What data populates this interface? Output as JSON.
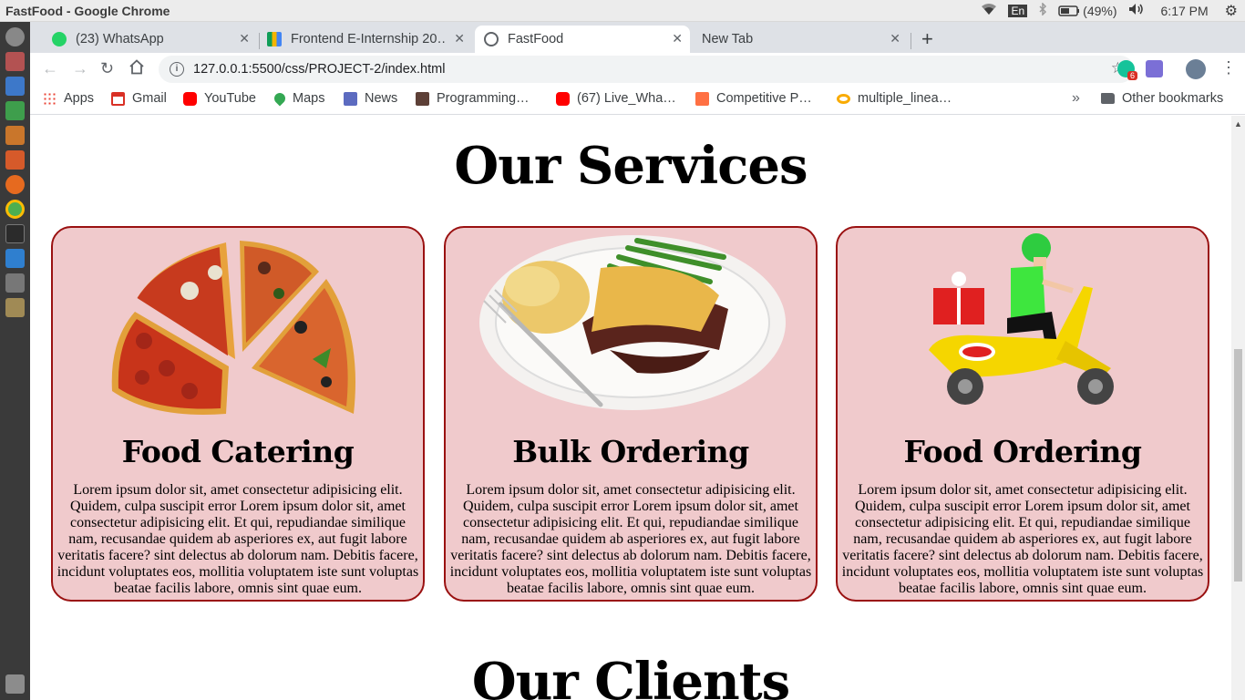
{
  "os": {
    "window_title": "FastFood - Google Chrome",
    "keyboard_layout": "En",
    "battery": "(49%)",
    "time": "6:17 PM"
  },
  "tabs": [
    {
      "label": "(23) WhatsApp",
      "badge": "23"
    },
    {
      "label": "Frontend E-Internship 20…"
    },
    {
      "label": "FastFood"
    },
    {
      "label": "New Tab"
    }
  ],
  "toolbar": {
    "url": "127.0.0.1:5500/css/PROJECT-2/index.html",
    "extension_badge": "6"
  },
  "bookmarks": [
    {
      "label": "Apps",
      "color": "#ea4335"
    },
    {
      "label": "Gmail",
      "color": "#d93025"
    },
    {
      "label": "YouTube",
      "color": "#ff0000"
    },
    {
      "label": "Maps",
      "color": "#34a853"
    },
    {
      "label": "News",
      "color": "#5c6bc0"
    },
    {
      "label": "Programming…",
      "color": "#5d4037"
    },
    {
      "label": "(67) Live_Wha…",
      "color": "#ff0000"
    },
    {
      "label": "Competitive P…",
      "color": "#ff7043"
    },
    {
      "label": "multiple_linea…",
      "color": "#f9ab00"
    }
  ],
  "other_bookmarks": "Other bookmarks",
  "page": {
    "services_heading": "Our Services",
    "clients_heading": "Our Clients",
    "cards": [
      {
        "title": "Food Catering",
        "image": "pizza-slices",
        "text": "Lorem ipsum dolor sit, amet consectetur adipisicing elit. Quidem, culpa suscipit error Lorem ipsum dolor sit, amet consectetur adipisicing elit. Et qui, repudiandae similique nam, recusandae quidem ab asperiores ex, aut fugit labore veritatis facere? sint delectus ab dolorum nam. Debitis facere, incidunt voluptates eos, mollitia voluptatem iste sunt voluptas beatae facilis labore, omnis sint quae eum."
      },
      {
        "title": "Bulk Ordering",
        "image": "meal-plate",
        "text": "Lorem ipsum dolor sit, amet consectetur adipisicing elit. Quidem, culpa suscipit error Lorem ipsum dolor sit, amet consectetur adipisicing elit. Et qui, repudiandae similique nam, recusandae quidem ab asperiores ex, aut fugit labore veritatis facere? sint delectus ab dolorum nam. Debitis facere, incidunt voluptates eos, mollitia voluptatem iste sunt voluptas beatae facilis labore, omnis sint quae eum."
      },
      {
        "title": "Food Ordering",
        "image": "delivery-scooter",
        "text": "Lorem ipsum dolor sit, amet consectetur adipisicing elit. Quidem, culpa suscipit error Lorem ipsum dolor sit, amet consectetur adipisicing elit. Et qui, repudiandae similique nam, recusandae quidem ab asperiores ex, aut fugit labore veritatis facere? sint delectus ab dolorum nam. Debitis facere, incidunt voluptates eos, mollitia voluptatem iste sunt voluptas beatae facilis labore, omnis sint quae eum."
      }
    ],
    "card_background": "#f0cacc",
    "card_border": "#9a1111"
  }
}
